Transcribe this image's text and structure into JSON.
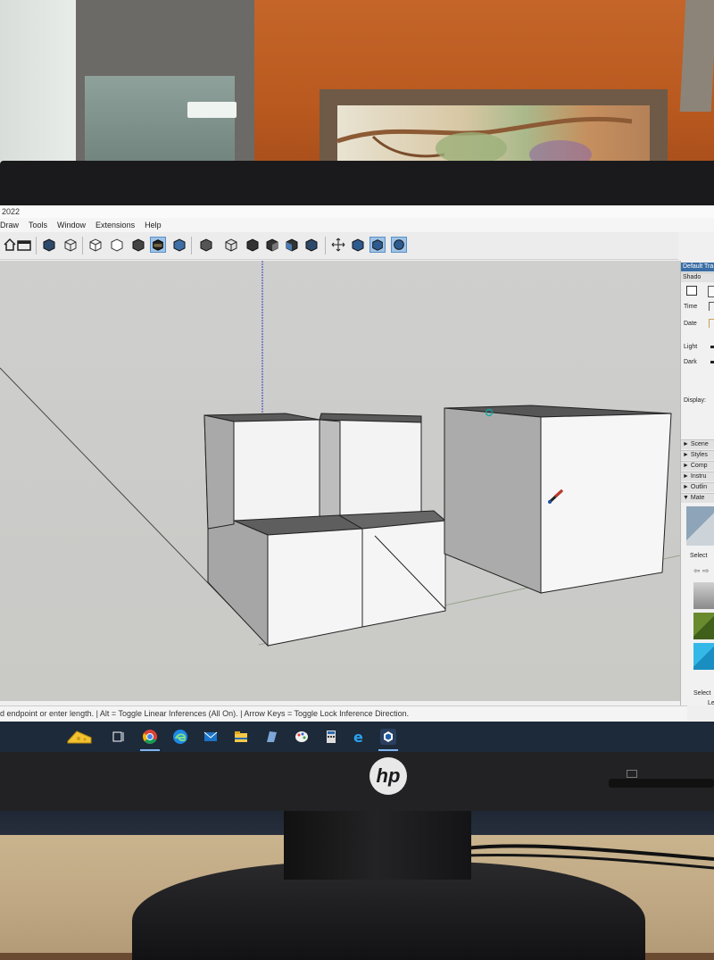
{
  "window": {
    "title": "2022"
  },
  "menu": {
    "items": [
      "Draw",
      "Tools",
      "Window",
      "Extensions",
      "Help"
    ]
  },
  "toolbar": {
    "icons": [
      "house-icon",
      "open-icon",
      "box-view-icon",
      "wireframe-icon",
      "hidden-line-icon",
      "shaded-icon",
      "shaded-texture-icon",
      "monochrome-icon",
      "xray-icon",
      "iso-icon",
      "top-view-icon",
      "front-view-icon",
      "right-view-icon",
      "back-view-icon",
      "left-view-icon",
      "orbit-icon",
      "pan-icon",
      "zoom-icon",
      "zoom-extents-icon"
    ]
  },
  "tray": {
    "title": "Default Tra",
    "shadows": {
      "header": "Shado",
      "time_label": "Time",
      "date_label": "Date",
      "light_label": "Light",
      "dark_label": "Dark",
      "display_label": "Display:"
    },
    "panels": [
      "Scene",
      "Styles",
      "Comp",
      "Instru",
      "Outlin",
      "Mate"
    ],
    "select_label": "Select",
    "bottom_select_label": "Select",
    "bottom_right_label": "Le",
    "swatch_colors": [
      "#9a9a9a",
      "#5a7a2e",
      "#2ea7d8"
    ]
  },
  "status": {
    "message": "d endpoint or enter length. | Alt = Toggle Linear Inferences (All On). | Arrow Keys = Toggle Lock Inference Direction."
  },
  "taskbar": {
    "apps": [
      "cheese-app-icon",
      "task-view-icon",
      "chrome-icon",
      "edge-icon",
      "mail-icon",
      "file-explorer-icon",
      "photos-icon",
      "paint-icon",
      "calculator-icon",
      "internet-explorer-icon",
      "sketchup-icon"
    ]
  },
  "monitor": {
    "brand": "hp"
  }
}
